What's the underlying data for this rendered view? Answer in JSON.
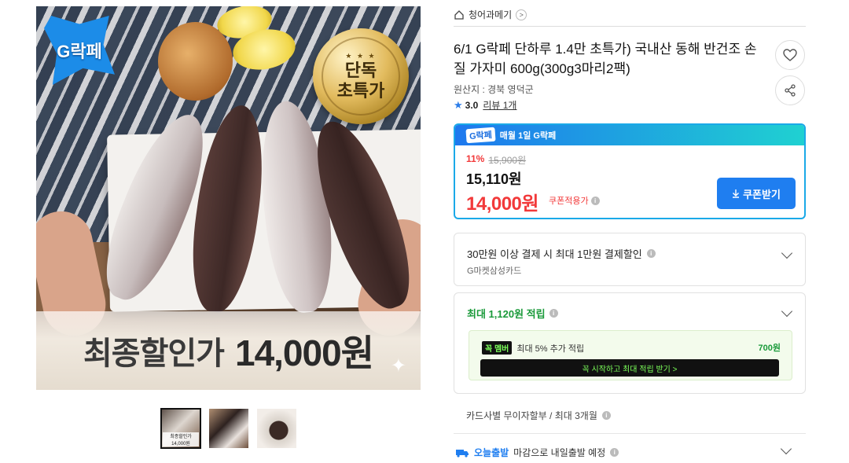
{
  "image": {
    "logo_text": "G락페",
    "seal_stars": "★ ★ ★",
    "seal_text": "단독\n초특가",
    "banner_label": "최종할인가",
    "banner_price": "14,000원"
  },
  "thumbnails": [
    {
      "caption": "최종할인가 14,000원",
      "active": true
    },
    {
      "caption": "",
      "active": false
    },
    {
      "caption": "",
      "active": false
    }
  ],
  "breadcrumb": {
    "category": "청어과메기"
  },
  "product": {
    "title": "6/1 G락페 단하루 1.4만 초특가) 국내산 동해 반건조 손질 가자미 600g(300g3마리2팩)",
    "origin": "원산지 : 경북 영덕군",
    "rating": "3.0",
    "review_link": "리뷰 1개"
  },
  "price": {
    "badge": "G락페",
    "header_text": "매월 1일 G락페",
    "discount_pct": "11%",
    "original_price": "15,900원",
    "sale_price": "15,110원",
    "coupon_price": "14,000원",
    "coupon_note": "쿠폰적용가",
    "coupon_button": "쿠폰받기"
  },
  "card_discount": {
    "title": "30만원 이상 결제 시 최대 1만원 결제할인",
    "subtitle": "G마켓삼성카드"
  },
  "points": {
    "title": "최대 1,120원 적립",
    "member_badge": "꼭 멤버",
    "member_text": "최대 5% 추가 적립",
    "member_amount": "700원",
    "member_button": "꼭 시작하고 최대 적립 받기  >"
  },
  "installment": "카드사별 무이자할부 / 최대 3개월",
  "shipping": {
    "badge": "오늘출발",
    "text": "마감으로 내일출발 예정"
  },
  "colors": {
    "accent_blue": "#1f7ef0",
    "sale_red": "#f2393a",
    "points_green": "#1a9a3a"
  }
}
